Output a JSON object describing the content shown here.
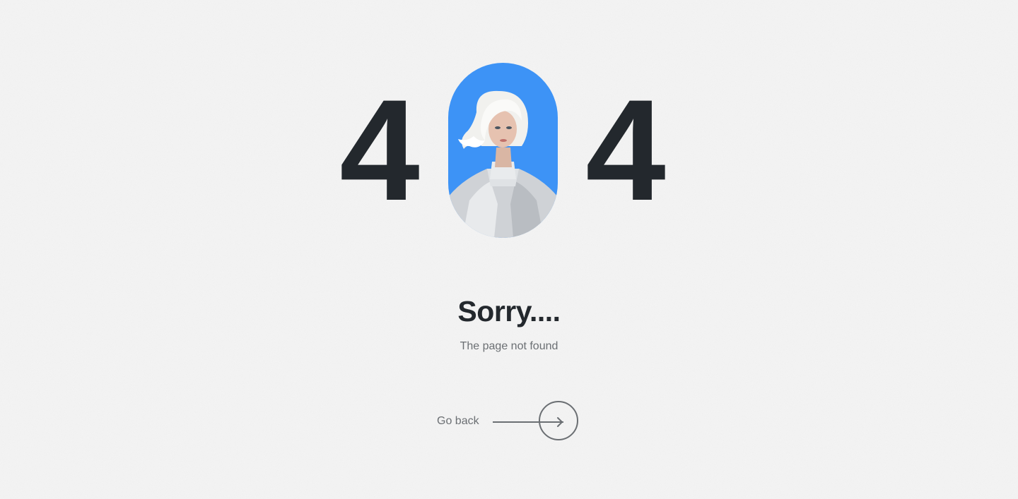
{
  "error_code": {
    "first_digit": "4",
    "last_digit": "4",
    "middle_digit_icon": "portrait-avatar-icon"
  },
  "message": {
    "title": "Sorry....",
    "subtitle": "The page not found"
  },
  "action": {
    "go_back_label": "Go back",
    "icon": "arrow-right-icon"
  },
  "colors": {
    "background": "#f4f4f4",
    "digit": "#23282d",
    "accent_blue": "#3d93f6",
    "muted_text": "#6b6f73"
  }
}
